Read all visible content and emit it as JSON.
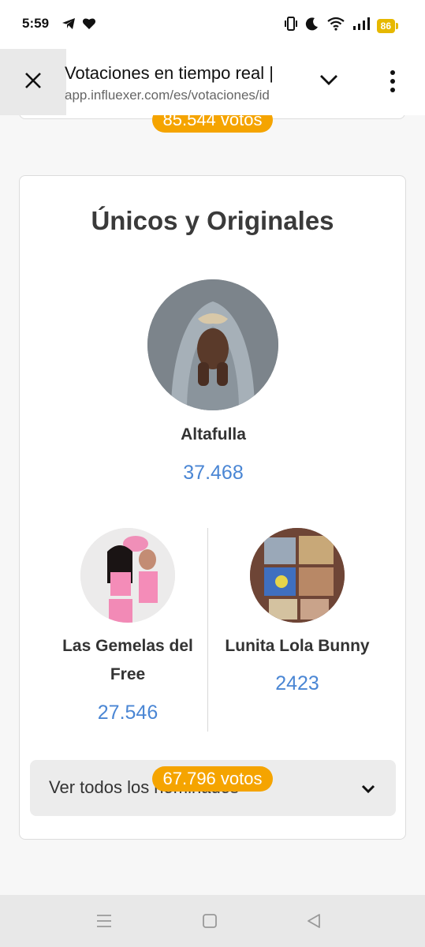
{
  "status_bar": {
    "time": "5:59",
    "battery": "86",
    "icons": [
      "telegram-icon",
      "heart-icon",
      "vibrate-icon",
      "moon-icon",
      "wifi-icon",
      "signal-icon",
      "battery-icon"
    ]
  },
  "tab_bar": {
    "title": "Votaciones en tiempo real |",
    "url": "app.influexer.com/es/votaciones/id"
  },
  "previous_category": {
    "votes_label": "85.544 votos"
  },
  "category": {
    "title": "Únicos y Originales",
    "winner": {
      "name": "Altafulla",
      "votes": "37.468"
    },
    "runners_up": [
      {
        "name": "Las Gemelas del Free",
        "votes": "27.546"
      },
      {
        "name": "Lunita Lola Bunny",
        "votes": "2423"
      }
    ],
    "see_all_label": "Ver todos los nominados",
    "total_votes_label": "67.796 votos"
  },
  "colors": {
    "accent_orange": "#f5a400",
    "votes_blue": "#4a86d4",
    "battery_yellow": "#e6b800"
  }
}
